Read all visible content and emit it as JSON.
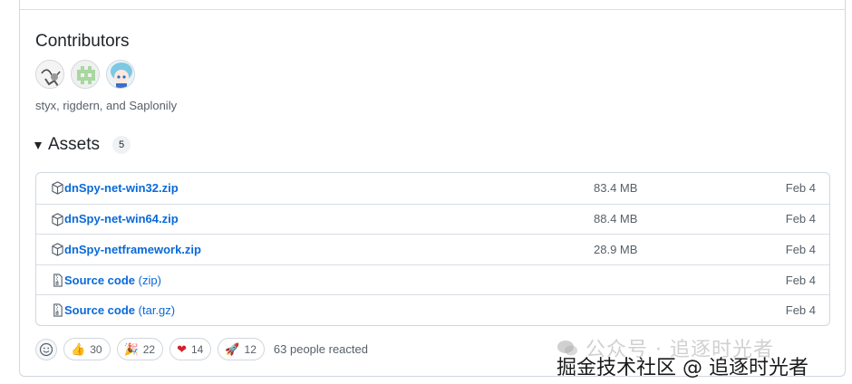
{
  "contributors": {
    "title": "Contributors",
    "avatars": [
      "avatar-styx",
      "avatar-rigdern",
      "avatar-saplonily"
    ],
    "names": "styx, rigdern, and Saplonily"
  },
  "assets": {
    "title": "Assets",
    "count": "5",
    "items": [
      {
        "name": "dnSpy-net-win32.zip",
        "sub": "",
        "size": "83.4 MB",
        "date": "Feb 4",
        "icon": "package-icon"
      },
      {
        "name": "dnSpy-net-win64.zip",
        "sub": "",
        "size": "88.4 MB",
        "date": "Feb 4",
        "icon": "package-icon"
      },
      {
        "name": "dnSpy-netframework.zip",
        "sub": "",
        "size": "28.9 MB",
        "date": "Feb 4",
        "icon": "package-icon"
      },
      {
        "name": "Source code",
        "sub": "(zip)",
        "size": "",
        "date": "Feb 4",
        "icon": "file-zip-icon"
      },
      {
        "name": "Source code",
        "sub": "(tar.gz)",
        "size": "",
        "date": "Feb 4",
        "icon": "file-zip-icon"
      }
    ]
  },
  "reactions": {
    "items": [
      {
        "emoji": "👍",
        "count": "30",
        "icon": "thumbs-up-icon"
      },
      {
        "emoji": "🎉",
        "count": "22",
        "icon": "party-icon"
      },
      {
        "emoji": "❤",
        "count": "14",
        "icon": "heart-icon"
      },
      {
        "emoji": "🚀",
        "count": "12",
        "icon": "rocket-icon"
      }
    ],
    "summary": "63 people reacted"
  },
  "watermark": {
    "line1": "公众号 · 追逐时光者",
    "line2": "掘金技术社区 @ 追逐时光者"
  },
  "colors": {
    "link": "#0969da",
    "muted": "#57606a",
    "border": "#d0d7de"
  }
}
